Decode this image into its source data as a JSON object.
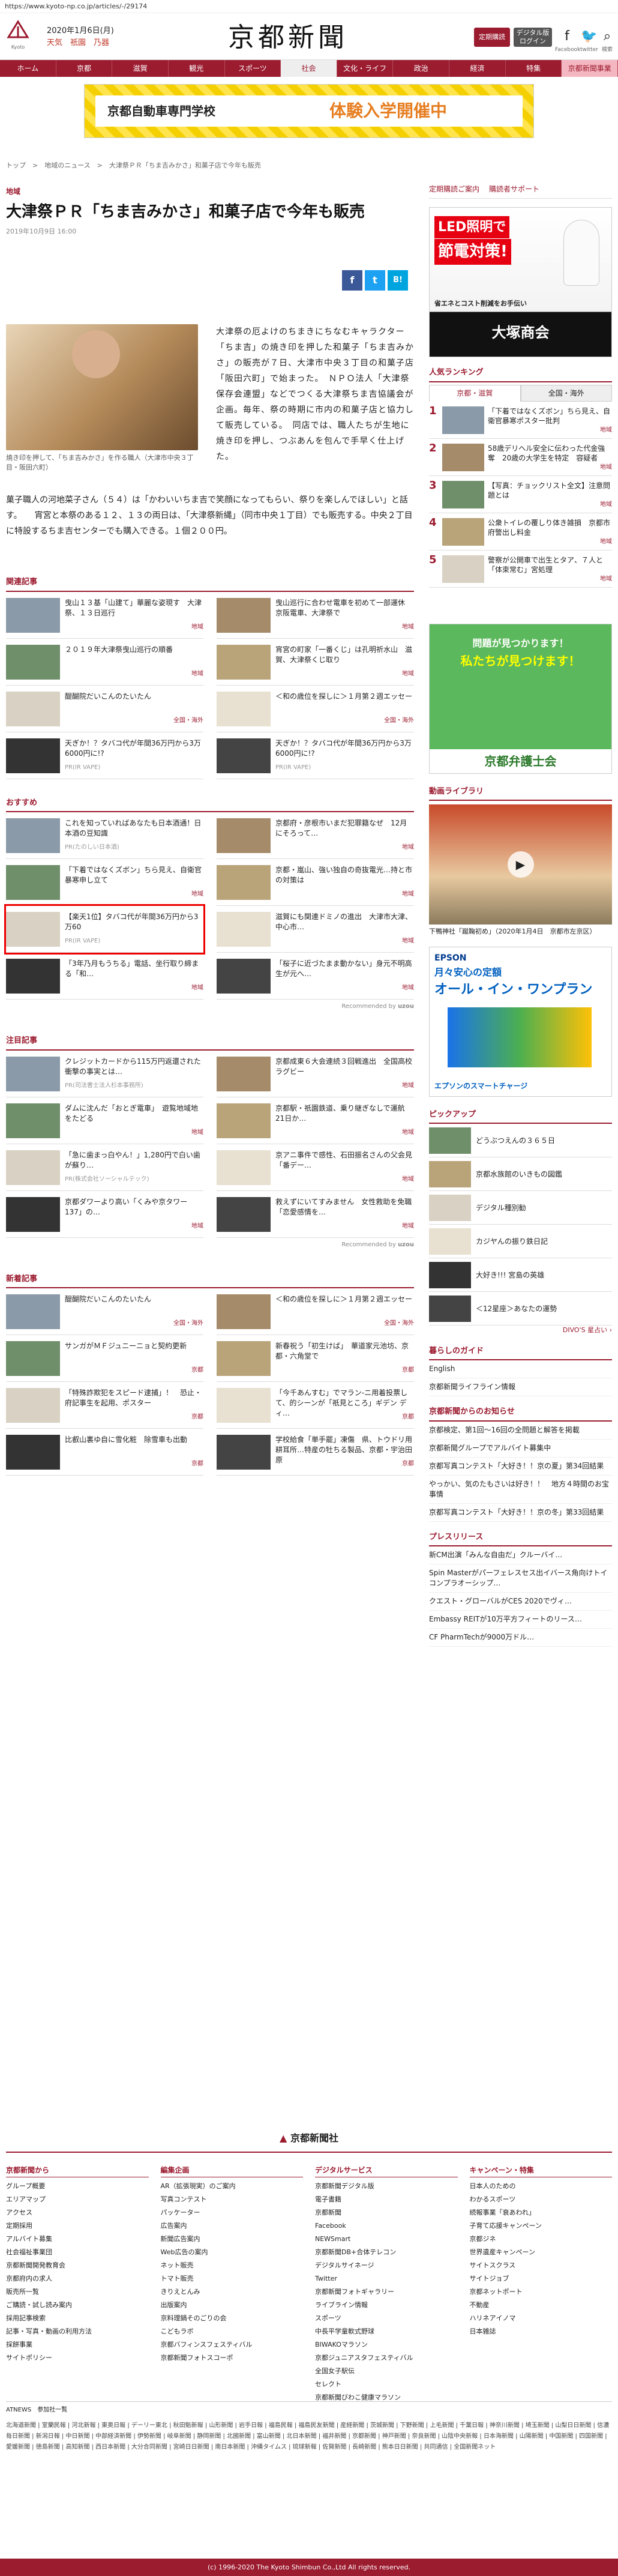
{
  "url": "https://www.kyoto-np.co.jp/articles/-/29174",
  "header": {
    "logo_label": "Kyoto",
    "date": "2020年1月6日(月)",
    "weather": "天気　祇園　乃器",
    "masthead": "京都新聞",
    "btn_shimen": "定期購読",
    "btn_login": "デジタル版\nログイン",
    "fb": "f",
    "fb_label": "Facebook",
    "tw": "🐦",
    "tw_label": "twitter",
    "search": "⌕",
    "search_label": "検索"
  },
  "nav": [
    "ホーム",
    "京都",
    "滋賀",
    "観光",
    "スポーツ",
    "社会",
    "文化・ライフ",
    "政治",
    "経済",
    "特集",
    "京都新聞事業"
  ],
  "ad_top": {
    "title": "京都自動車専門学校",
    "cta": "体験入学開催中"
  },
  "breadcrumb": "トップ　>　地域のニュース　>　大津祭ＰＲ「ちま吉みかさ」和菓子店で今年も販売",
  "article": {
    "section": "地域",
    "title": "大津祭ＰＲ「ちま吉みかさ」和菓子店で今年も販売",
    "date": "2019年10月9日 16:00",
    "caption": "焼き印を押して、「ちま吉みかさ」を作る職人（大津市中央３丁目・阪田六町）",
    "lead": "大津祭の厄よけのちまきにちなむキャラクター「ちま吉」の焼き印を押した和菓子「ちま吉みかさ」の販売が７日、大津市中央３丁目の和菓子店「阪田六町」で始まった。　ＮＰＯ法人「大津祭保存会連盟」などでつくる大津祭ちま吉協議会が企画。毎年、祭の時期に市内の和菓子店と協力して販売している。　同店では、職人たちが生地に焼き印を押し、つぶあんを包んで手早く仕上げた。",
    "body": "菓子職人の河地菜子さん（５４）は「かわいいちま吉で笑顔になってもらい、祭りを楽しんでほしい」と話す。　　宵宮と本祭のある１２、１３の両日は、「大津祭新縄」（同市中央１丁目）でも販売する。中央２丁目に特設するちま吉センターでも購入できる。１個２００円。",
    "share": {
      "fb": "f",
      "tw": "t",
      "hb": "B!"
    }
  },
  "related": {
    "title": "関連記事",
    "items": [
      {
        "text": "曳山１３基「山建て」華麗な姿現す　大津祭、１３日巡行",
        "cat": "地域"
      },
      {
        "text": "曳山巡行に合わせ電車を初めて一部運休　京阪電車、大津祭で",
        "cat": "地域"
      },
      {
        "text": "２０１９年大津祭曳山巡行の順番",
        "cat": "地域"
      },
      {
        "text": "宵宮の町家「一番くじ」は孔明祈水山　滋賀、大津祭くじ取り",
        "cat": "地域"
      },
      {
        "text": "醍醐院だいこんのたいたん",
        "cat": "全国・海外"
      },
      {
        "text": "＜和の歳位を探しに＞１月第２週エッセー",
        "cat": "全国・海外"
      },
      {
        "text": "天ぎか！？タバコ代が年間36万円から3万6000円に!?",
        "pr": "PR(IR VAPE)"
      },
      {
        "text": "天ぎか！？タバコ代が年間36万円から3万6000円に!?",
        "pr": "PR(IR VAPE)"
      }
    ]
  },
  "osusume": {
    "title": "おすすめ",
    "items": [
      {
        "text": "これを知っていればあなたも日本酒通！日本酒の豆知識",
        "pr": "PR(たのしい日本酒)"
      },
      {
        "text": "京都府・彦根市いまだ犯罪籍なぜ　12月にそろって…",
        "cat": "地域"
      },
      {
        "text": "「下着ではなくズボン」ちら見え、自衛官暴寒申し立て",
        "cat": "地域"
      },
      {
        "text": "京都・嵐山、強い独自の奇抜電光…持と市の対策は",
        "cat": "地域"
      },
      {
        "text": "【楽天1位】タバコ代が年間36万円から3万60",
        "pr": "PR(IR VAPE)"
      },
      {
        "text": "滋賀にも関連ドミノの進出　大津市大津、中心市…",
        "cat": "地域"
      },
      {
        "text": "「3年乃月もうちる」電話、坐行取り締まる「和…",
        "cat": "地域"
      },
      {
        "text": "「桜子に近づたまま動かない」身元不明高生が元へ…",
        "cat": "地域"
      }
    ],
    "rec": "Recommended by"
  },
  "chumoku": {
    "title": "注目記事",
    "items": [
      {
        "text": "クレジットカードから115万円返還された衝撃の事実とは…",
        "pr": "PR(司法書士法人杉本事務所)"
      },
      {
        "text": "京都成東６大会連続３回戦進出　全国高校ラグビー",
        "cat": "地域"
      },
      {
        "text": "ダムに沈んだ「おとぎ電車」　遊覧地域地をたどる",
        "cat": "地域"
      },
      {
        "text": "京都駅・祇園鉄道、乗り継ぎなしで運航　21日か…",
        "cat": "地域"
      },
      {
        "text": "「急に歯まっ白やん！」1,280円で白い歯が蘇り…",
        "pr": "PR(株式会社ソーシャルテック)"
      },
      {
        "text": "京アニ事件で感性、石田振名さんの父会見「番デー…",
        "cat": "地域"
      },
      {
        "text": "京都ダワーより高い「くみや京タワー137」の…",
        "cat": "地域"
      },
      {
        "text": "救えずにいてすみません　女性救助を免職「恋愛感情を…",
        "cat": "地域"
      }
    ]
  },
  "shinchaku": {
    "title": "新着記事",
    "items": [
      {
        "text": "醍醐院だいこんのたいたん",
        "cat": "全国・海外"
      },
      {
        "text": "＜和の歳位を探しに＞１月第２週エッセー",
        "cat": "全国・海外"
      },
      {
        "text": "サンガがＭＦジュニーニョと契約更新",
        "cat": "京都"
      },
      {
        "text": "新春祝う「初生けば」　華道家元池坊、京都・六角堂で",
        "cat": "京都"
      },
      {
        "text": "「特殊詐欺犯をスピード逮捕」！　恐止・府記事生を起用、ポスター",
        "cat": "京都"
      },
      {
        "text": "「今千あんすむ」でマラン-ニ用着投票して、的シーンが「祇見ところ」ギデン ディ…",
        "cat": "京都"
      },
      {
        "text": "比叡山裏ゆ自に雪化粧　除雪車も出動",
        "cat": "京都"
      },
      {
        "text": "学校給食「単手罷」凍傷　県、トウドリ用耕耳所…特産の牡ちる製品、京都・宇治田原",
        "cat": "京都"
      }
    ]
  },
  "side": {
    "links": [
      "定期購読ご案内",
      "購読者サポート"
    ],
    "ad1": {
      "t1": "LED照明で",
      "t2": "節電対策!",
      "t3": "省エネとコスト削減をお手伝い",
      "t4": "大塚商会"
    },
    "ranking": {
      "title": "人気ランキング",
      "tabs": [
        "京都・滋賀",
        "全国・海外"
      ],
      "items": [
        {
          "n": "1",
          "text": "「下着ではなくズボン」ちら見え、自衛官暴寒ポスター批判",
          "cat": "地域"
        },
        {
          "n": "2",
          "text": "58歳デリヘル安全に伝わった代金強奪　20歳の大学生を特定　容疑者",
          "cat": "地域"
        },
        {
          "n": "3",
          "text": "【写真：チョックリスト全文】注意問題とは",
          "cat": "地域"
        },
        {
          "n": "4",
          "text": "公衆トイレの覆しり体き雑損　京都市　府警出し料金",
          "cat": "地域"
        },
        {
          "n": "5",
          "text": "警察が公開車で出生とタア、７人と「体束常む」宮処理",
          "cat": "地域"
        }
      ]
    },
    "ad2": {
      "t1": "問題が見つかります！",
      "t2": "私たちが見つけます！",
      "t3": "京都弁護士会"
    },
    "video": {
      "title": "動画ライブラリ",
      "caption": "下鴨神社「蹴鞠初め」（2020年1月4日　京都市左京区）"
    },
    "ad3": {
      "t1": "EPSON",
      "t2": "月々安心の定額",
      "t3": "オール・イン・ワンプラン",
      "t4": "エプソンのスマートチャージ"
    },
    "pickup": {
      "title": "ピックアップ",
      "items": [
        "どうぶつえんの３６５日",
        "京都水族館のいきもの図鑑",
        "デジタル種別勧",
        "カジヤんの振り鉄日記",
        "大好き!!! 宮島の英雄",
        "＜12星座＞あなたの運勢"
      ],
      "divo": "DIVO'S 星占い ›"
    },
    "minna": {
      "title": "暮らしのガイド",
      "items": [
        "English",
        "京都新聞ライフライン情報"
      ]
    },
    "oshirase": {
      "title": "京都新聞からのお知らせ",
      "items": [
        "京都検定、第1回～16回の全問題と解答を掲載",
        "京都新聞グループでアルバイト募集中",
        "京都写真コンテスト「大好き！！京の夏」第34回結果",
        "やっかい、気のたもさいは好き！！　地方４時間のお宝事情",
        "京都写真コンテスト「大好き！！京の冬」第33回結果"
      ]
    },
    "press": {
      "title": "プレスリリース",
      "items": [
        "新CM出演「みんな自由だ」クルーバイ…",
        "Spin Masterがパーフェレスセス出イバース角向けトイコンプラオーシップ…",
        "クエスト・グローバルがCES 2020でヴィ…",
        "Embassy REITが10万平方フィートのリース…",
        "CF PharmTechが9000万ドル…"
      ]
    }
  },
  "footer": {
    "brand": "京都新聞社",
    "cols": [
      {
        "title": "京都新聞から",
        "items": [
          "グループ概要",
          "エリアマップ",
          "アクセス",
          "定期採用",
          "アルバイト募集",
          "社会福祉事業団",
          "京都新聞開発教育会",
          "京都府内の求人",
          "販売所一覧",
          "ご購読・試し読み案内",
          "採用記事検索",
          "記事・写真・動画の利用方法",
          "採餅事業",
          "サイトポリシー"
        ]
      },
      {
        "title": "編集企画",
        "items": [
          "AR（拡張現実）のご案内",
          "写真コンテスト",
          "パッケーター",
          "広告案内",
          "新聞広告案内",
          "Web広告の案内",
          "ネット販売",
          "トマト販売",
          "きりえとんみ",
          "出版案内",
          "京料理鍋そのごりの会",
          "こどもラボ",
          "京都バフィンスフェスティバル",
          "京都新聞フォトスコーポ"
        ]
      },
      {
        "title": "デジタルサービス",
        "items": [
          "京都新聞デジタル版",
          "電子書籍",
          "京都新聞",
          "Facebook",
          "NEWSmart",
          "京都新聞DB+合体テレコン",
          "デジタルサイネージ",
          "Twitter",
          "京都新聞フォトギャラリー",
          "ライブライン情報",
          "スポーツ",
          "中長平学童軟式野球",
          "BIWAKOマラソン",
          "京都ジュニアスタフェスティバル",
          "全国女子駅伝",
          "セレクト",
          "京都新聞びわこ健康マラソン"
        ]
      },
      {
        "title": "キャンペーン・特集",
        "items": [
          "日本人のための",
          "わかるスポーツ",
          "続報事業「衰あわれ」",
          "子育て応援キャンペーン",
          "京都ジネ",
          "世界遺産キャンペーン",
          "サイトスクラス",
          "サイトジョブ",
          "京都ネットポート",
          "不動産",
          "ハリネアイノマ",
          "日本雑誌"
        ]
      }
    ],
    "atnews": "ATNEWS　参加社一覧",
    "atlinks": "北海道新聞 | 室蘭民報 | 河北新報 | 東奥日報 | デーリー東北 | 秋田魁新報 | 山形新聞 | 岩手日報 | 福島民報 | 福島民友新聞 | 産経新聞 | 茨城新聞 | 下野新聞 | 上毛新聞 | 千葉日報 | 神奈川新聞 | 埼玉新聞 | 山梨日日新聞 | 信濃毎日新聞 | 新潟日報 | 中日新聞 | 中部経済新聞 | 伊勢新聞 | 岐阜新聞 | 静岡新聞 | 北國新聞 | 富山新聞 | 北日本新聞 | 福井新聞 | 京都新聞 | 神戸新聞 | 奈良新聞 | 山陰中央新報 | 日本海新聞 | 山陽新聞 | 中国新聞 | 四国新聞 | 愛媛新聞 | 徳島新聞 | 高知新聞 | 西日本新聞 | 大分合同新聞 | 宮崎日日新聞 | 南日本新聞 | 沖縄タイムス | 琉球新報 | 佐賀新聞 | 長崎新聞 | 熊本日日新聞 | 共同通信 | 全国新聞ネット",
    "copyright": "(c) 1996-2020 The Kyoto Shimbun Co.,Ltd All rights reserved."
  }
}
